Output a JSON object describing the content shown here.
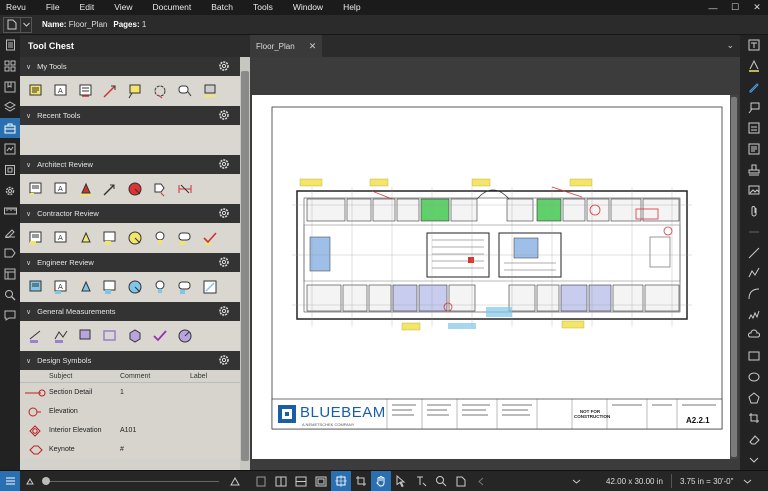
{
  "menu": [
    "Revu",
    "File",
    "Edit",
    "View",
    "Document",
    "Batch",
    "Tools",
    "Window",
    "Help"
  ],
  "window_controls": [
    "—",
    "☐",
    "✕"
  ],
  "doc_toolbar": {
    "name_label": "Name:",
    "name_value": "Floor_Plan",
    "pages_label": "Pages:",
    "pages_value": "1"
  },
  "tool_chest": {
    "title": "Tool Chest",
    "sections": [
      {
        "label": "My Tools"
      },
      {
        "label": "Recent Tools"
      },
      {
        "label": "Architect Review"
      },
      {
        "label": "Contractor Review"
      },
      {
        "label": "Engineer Review"
      },
      {
        "label": "General Measurements"
      },
      {
        "label": "Design Symbols"
      }
    ],
    "design_symbols_columns": [
      "Subject",
      "Comment",
      "Label"
    ],
    "design_symbols_rows": [
      {
        "subject": "Section Detail",
        "comment": "1",
        "label": ""
      },
      {
        "subject": "Elevation",
        "comment": "",
        "label": ""
      },
      {
        "subject": "Interior Elevation",
        "comment": "A101",
        "label": ""
      },
      {
        "subject": "Keynote",
        "comment": "#",
        "label": ""
      }
    ]
  },
  "tabs": [
    {
      "label": "Floor_Plan"
    }
  ],
  "title_block": {
    "logo_text": "BLUEBEAM",
    "logo_sub": "A NEMETSCHEK COMPANY",
    "stamp": "NOT FOR CONSTRUCTION",
    "sheet_number": "A2.2.1"
  },
  "status": {
    "dimensions": "42.00 x 30.00 in",
    "scale": "3.75 in = 30'-0\""
  },
  "colors": {
    "accent": "#2a6fb0",
    "bluebeam_blue": "#1a5ea8"
  }
}
